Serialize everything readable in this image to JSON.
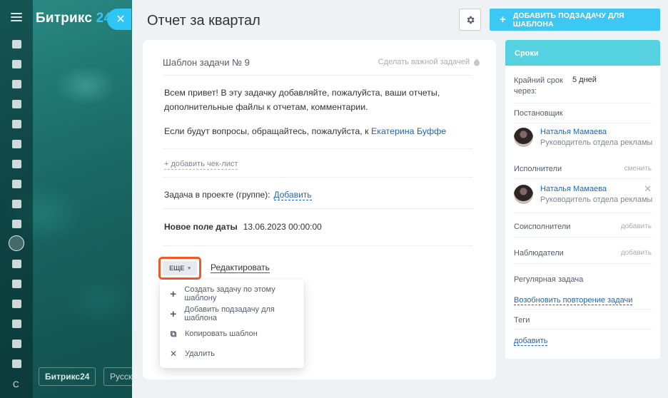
{
  "brand": {
    "name": "Битрикс",
    "number": "24",
    "footer_logo": "Битрикс24",
    "language": "Русский"
  },
  "header": {
    "title": "Отчет за квартал",
    "add_subtask_label": "ДОБАВИТЬ ПОДЗАДАЧУ ДЛЯ ШАБЛОНА"
  },
  "card": {
    "template_title": "Шаблон задачи № 9",
    "make_important": "Сделать важной задачей",
    "description_p1": "Всем привет! В эту задачку добавляйте, пожалуйста, ваши отчеты, дополнительные файлы к отчетам, комментарии.",
    "description_p2_text": "Если будут вопросы, обращайтесь, пожалуйста, к ",
    "description_p2_link": "Екатерина Буффе",
    "add_checklist": "+ добавить чек-лист",
    "project_label": "Задача в проекте (группе):",
    "project_add": "Добавить",
    "date_field_label": "Новое поле даты",
    "date_field_value": "13.06.2023 00:00:00",
    "more_button": "ЕЩЕ",
    "edit_link": "Редактировать"
  },
  "menu": {
    "items": [
      {
        "label": "Создать задачу по этому шаблону",
        "icon": "plus-icon"
      },
      {
        "label": "Добавить подзадачу для шаблона",
        "icon": "plus-icon"
      },
      {
        "label": "Копировать шаблон",
        "icon": "copy-icon"
      },
      {
        "label": "Удалить",
        "icon": "close-icon"
      }
    ]
  },
  "sidebar": {
    "header": "Сроки",
    "deadline_label": "Крайний срок через:",
    "deadline_value": "5 дней",
    "creator_label": "Постановщик",
    "creator": {
      "name": "Наталья Мамаева",
      "role": "Руководитель отдела рекламы"
    },
    "assignees_label": "Исполнители",
    "assignees_change": "сменить",
    "assignee": {
      "name": "Наталья Мамаева",
      "role": "Руководитель отдела рекламы"
    },
    "coexecutors_label": "Соисполнители",
    "coexecutors_add": "добавить",
    "observers_label": "Наблюдатели",
    "observers_add": "добавить",
    "recurring_label": "Регулярная задача",
    "recurring_link": "Возобновить повторение задачи",
    "tags_label": "Теги",
    "tags_add": "добавить"
  },
  "colors": {
    "accent": "#3bc8f5",
    "sidebar_header": "#56d1e0",
    "highlight": "#ef5a2a",
    "link": "#2067b0"
  }
}
